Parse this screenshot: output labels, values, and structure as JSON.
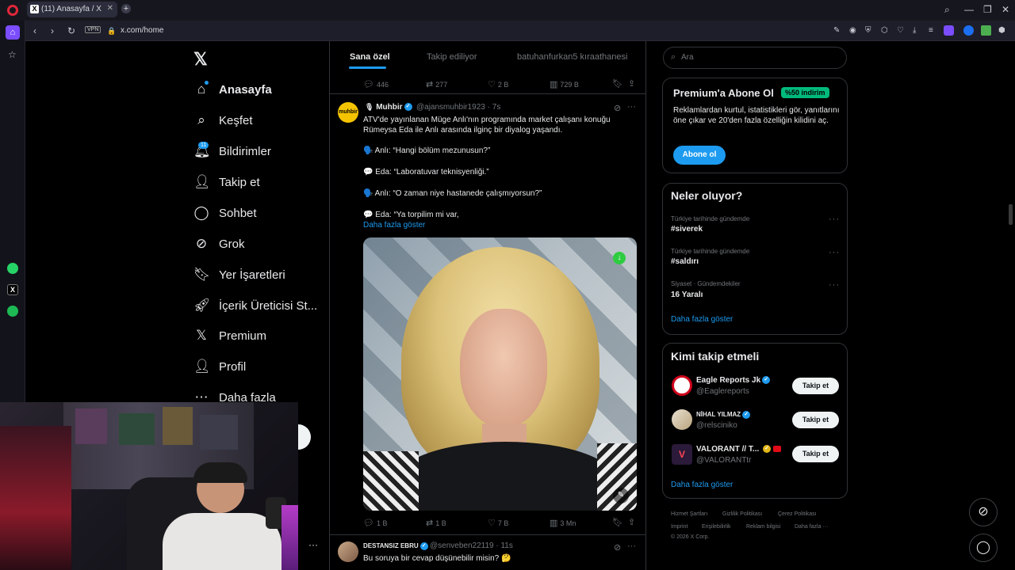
{
  "browser": {
    "tab_title": "(11) Anasayfa / X",
    "url": "x.com/home",
    "vpn_label": "VPN"
  },
  "nav": {
    "items": [
      {
        "label": "Anasayfa",
        "icon": "home-icon"
      },
      {
        "label": "Keşfet",
        "icon": "search-icon"
      },
      {
        "label": "Bildirimler",
        "icon": "bell-icon"
      },
      {
        "label": "Takip et",
        "icon": "follow-icon"
      },
      {
        "label": "Sohbet",
        "icon": "chat-icon"
      },
      {
        "label": "Grok",
        "icon": "grok-icon"
      },
      {
        "label": "Yer İşaretleri",
        "icon": "bookmark-icon"
      },
      {
        "label": "İçerik Üreticisi St...",
        "icon": "rocket-icon"
      },
      {
        "label": "Premium",
        "icon": "x-logo-icon"
      },
      {
        "label": "Profil",
        "icon": "profile-icon"
      },
      {
        "label": "Daha fazla",
        "icon": "more-icon"
      }
    ],
    "notif_badge": "11"
  },
  "feed": {
    "tabs": [
      "Sana özel",
      "Takip ediliyor",
      "batuhanfurkan5 kıraathanesi"
    ],
    "prev_actions": {
      "replies": "446",
      "reposts": "277",
      "likes": "2 B",
      "views": "729 B"
    },
    "tweet": {
      "name": "Muhbir",
      "handle": "@ajansmuhbir1923",
      "time": "· 7s",
      "avatar_text": "muhbir",
      "text_intro": "ATV'de yayınlanan Müge Anlı'nın programında market çalışanı konuğu Rümeysa Eda ile Anlı arasında ilginç bir diyalog yaşandı.",
      "lines": [
        "🗣️ Anlı: “Hangi bölüm mezunusun?”",
        "💬 Eda: “Laboratuvar teknisyenliği.”",
        "🗣️ Anlı: “O zaman niye hastanede çalışmıyorsun?”",
        "💬 Eda: “Ya torpilim mi var,"
      ],
      "show_more": "Daha fazla göster",
      "actions": {
        "replies": "1 B",
        "reposts": "1 B",
        "likes": "7 B",
        "views": "3 Mn"
      }
    },
    "next_tweet": {
      "name": "DESTANSIZ EBRU",
      "handle": "@senveben22119",
      "time": "· 11s",
      "text": "Bu soruya bir cevap düşünebilir misin? 🤔"
    }
  },
  "right": {
    "search_placeholder": "Ara",
    "premium": {
      "title": "Premium'a Abone Ol",
      "discount": "%50 indirim",
      "body": "Reklamlardan kurtul, istatistikleri gör, yanıtlarını öne çıkar ve 20'den fazla özelliğin kilidini aç.",
      "button": "Abone ol"
    },
    "trends": {
      "title": "Neler oluyor?",
      "items": [
        {
          "context": "Türkiye tarihinde gündemde",
          "name": "#siverek"
        },
        {
          "context": "Türkiye tarihinde gündemde",
          "name": "#saldırı"
        },
        {
          "context": "Siyaset · Gündemdekiler",
          "name": "16 Yaralı"
        }
      ],
      "show_more": "Daha fazla göster"
    },
    "who_to_follow": {
      "title": "Kimi takip etmeli",
      "items": [
        {
          "name": "Eagle Reports Jk",
          "handle": "@Eaglereports",
          "button": "Takip et"
        },
        {
          "name": "NİHAL YILMAZ",
          "handle": "@relsciniko",
          "button": "Takip et"
        },
        {
          "name": "VALORANT // T...",
          "handle": "@VALORANTtr",
          "button": "Takip et"
        }
      ],
      "show_more": "Daha fazla göster"
    },
    "footer": {
      "links": [
        "Hizmet Şartları",
        "Gizlilik Politikası",
        "Çerez Politikası",
        "Imprint",
        "Erişilebilirlik",
        "Reklam bilgisi",
        "Daha fazla ···"
      ],
      "copyright": "© 2026 X Corp."
    }
  },
  "colors": {
    "accent": "#1d9bf0",
    "premium_badge": "#00ba7c",
    "background": "#000000",
    "border": "#2f3336"
  }
}
